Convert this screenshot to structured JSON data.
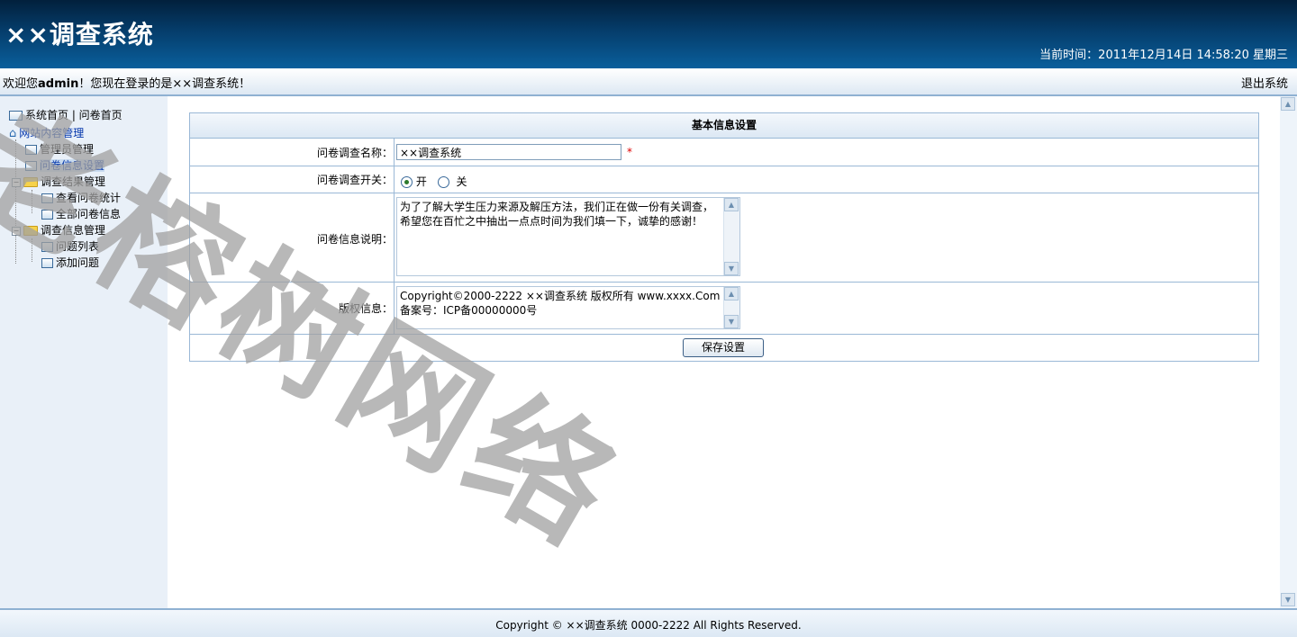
{
  "header": {
    "title": "××调查系统",
    "current_time": "当前时间：2011年12月14日  14:58:20 星期三"
  },
  "infobar": {
    "welcome_prefix": "欢迎您",
    "username": "admin",
    "welcome_suffix": "！您现在登录的是××调查系统！",
    "logout": "退出系统"
  },
  "sidebar": {
    "top_links": "系统首页 | 问卷首页",
    "root": "网站内容管理",
    "items": [
      {
        "label": "管理员管理"
      },
      {
        "label": "问卷信息设置"
      },
      {
        "label": "调查结果管理"
      },
      {
        "label": "查看问卷统计"
      },
      {
        "label": "全部问卷信息"
      },
      {
        "label": "调查信息管理"
      },
      {
        "label": "问题列表"
      },
      {
        "label": "添加问题"
      }
    ]
  },
  "form": {
    "heading": "基本信息设置",
    "name_label": "问卷调查名称：",
    "name_value": "××调查系统",
    "required_mark": "*",
    "switch_label": "问卷调查开关：",
    "switch_on": "开",
    "switch_off": "关",
    "switch_state": "on",
    "desc_label": "问卷信息说明：",
    "desc_value": "为了了解大学生压力来源及解压方法，我们正在做一份有关调查，希望您在百忙之中抽出一点点时间为我们填一下，诚挚的感谢！",
    "copyright_label": "版权信息：",
    "copyright_value": "Copyright©2000-2222 ××调查系统 版权所有 www.xxxx.Com 备案号：ICP备00000000号",
    "save_button": "保存设置"
  },
  "footer": {
    "copyright": "Copyright © ××调查系统  0000-2222 All Rights Reserved."
  },
  "watermark": "老榕树网络"
}
